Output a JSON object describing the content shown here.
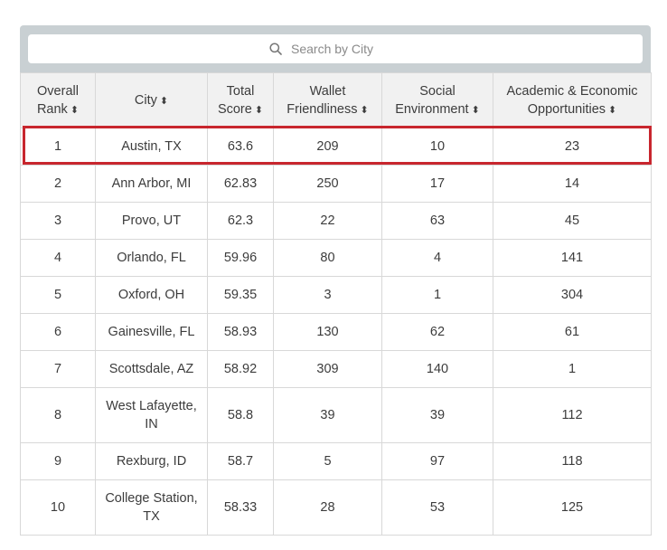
{
  "search": {
    "placeholder": "Search by City",
    "icon": "search-icon"
  },
  "columns": [
    {
      "label": "Overall Rank",
      "sort_glyph": "⬍"
    },
    {
      "label": "City",
      "sort_glyph": "⬍"
    },
    {
      "label": "Total Score",
      "sort_glyph": "⬍"
    },
    {
      "label": "Wallet Friendliness",
      "sort_glyph": "⬍"
    },
    {
      "label": "Social Environment",
      "sort_glyph": "⬍"
    },
    {
      "label": "Academic & Economic Opportunities",
      "sort_glyph": "⬍"
    }
  ],
  "rows": [
    [
      "1",
      "Austin, TX",
      "63.6",
      "209",
      "10",
      "23"
    ],
    [
      "2",
      "Ann Arbor, MI",
      "62.83",
      "250",
      "17",
      "14"
    ],
    [
      "3",
      "Provo, UT",
      "62.3",
      "22",
      "63",
      "45"
    ],
    [
      "4",
      "Orlando, FL",
      "59.96",
      "80",
      "4",
      "141"
    ],
    [
      "5",
      "Oxford, OH",
      "59.35",
      "3",
      "1",
      "304"
    ],
    [
      "6",
      "Gainesville, FL",
      "58.93",
      "130",
      "62",
      "61"
    ],
    [
      "7",
      "Scottsdale, AZ",
      "58.92",
      "309",
      "140",
      "1"
    ],
    [
      "8",
      "West Lafayette, IN",
      "58.8",
      "39",
      "39",
      "112"
    ],
    [
      "9",
      "Rexburg, ID",
      "58.7",
      "5",
      "97",
      "118"
    ],
    [
      "10",
      "College Station, TX",
      "58.33",
      "28",
      "53",
      "125"
    ]
  ],
  "highlight_color": "#c8262e",
  "header_bg": "#f1f1f1"
}
